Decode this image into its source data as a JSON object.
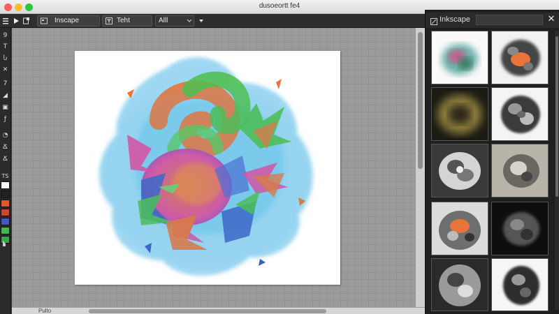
{
  "window": {
    "title": "dusoeortt fe4",
    "traffic_lights": {
      "close": "#ff5f57",
      "minimize": "#febc2e",
      "zoom": "#28c840"
    }
  },
  "toolbar": {
    "menu_icon": "hamburger-icon",
    "play_icon": "play-icon",
    "export_icon": "export-icon",
    "app_icon": "app-icon",
    "app_label": "Inscape",
    "text_icon": "text-icon",
    "text_field": "Teht",
    "scope_select": "Alll"
  },
  "tools": {
    "labels": [
      "9",
      "T",
      "Ⴑ",
      "✕",
      "7",
      "◢",
      "▣",
      "ƒ",
      "◔",
      "Ճ",
      "Ճ"
    ],
    "swatch_label": "TS",
    "swatches": [
      "#ffffff",
      "#222222",
      "#e2582a",
      "#c94a2a",
      "#3d5bbd",
      "#49b54a",
      "#2fa84a"
    ]
  },
  "panel": {
    "title": "Inkscape",
    "search_value": "",
    "close_icon": "close-icon",
    "thumbnail_count": 12
  },
  "status": {
    "text": "Pulto"
  },
  "artwork": {
    "colors": {
      "cyan": "#4fb8e6",
      "orange": "#e8743a",
      "green": "#4cc04a",
      "magenta": "#e24a9e",
      "blue": "#3a5fc4",
      "purple": "#7a4fc0"
    }
  }
}
